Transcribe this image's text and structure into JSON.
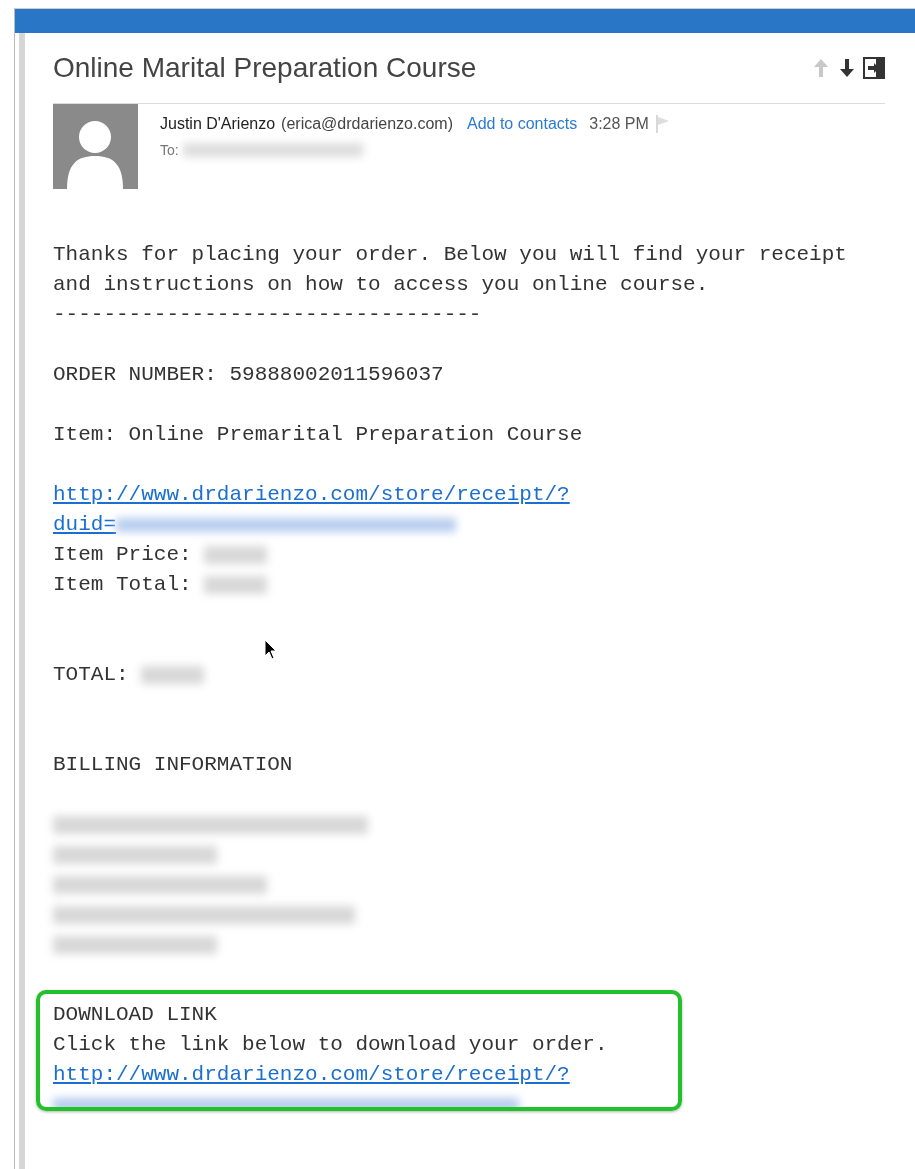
{
  "window": {
    "title": "Online Marital Preparation Course"
  },
  "toolbar_buttons": [
    {
      "kind": "previous",
      "disabled": true
    },
    {
      "kind": "next",
      "disabled": false
    },
    {
      "kind": "pop-out",
      "disabled": false
    }
  ],
  "sender": {
    "name": "Justin D'Arienzo",
    "email": "(erica@drdarienzo.com)",
    "add_contact": "Add to contacts",
    "time": "3:28 PM",
    "to_label": "To:"
  },
  "body_lines": [
    {
      "kind": "text",
      "text": "Thanks for placing your order. Below you will find your receipt"
    },
    {
      "kind": "text",
      "text": "and instructions on how to access you online course."
    },
    {
      "kind": "text",
      "text": "----------------------------------"
    },
    {
      "kind": "blank"
    },
    {
      "kind": "text",
      "text": "ORDER NUMBER: 59888002011596037"
    },
    {
      "kind": "blank"
    },
    {
      "kind": "text",
      "text": "Item: Online Premarital Preparation Course"
    },
    {
      "kind": "blank"
    },
    {
      "kind": "link",
      "text": "http://www.drdarienzo.com/store/receipt/?"
    },
    {
      "kind": "link-redacted",
      "text": "duid="
    },
    {
      "kind": "text-redacted",
      "text": "Item Price:"
    },
    {
      "kind": "text-redacted",
      "text": "Item Total:"
    },
    {
      "kind": "blank"
    },
    {
      "kind": "blank"
    },
    {
      "kind": "text-redacted",
      "text": "TOTAL:"
    },
    {
      "kind": "blank"
    },
    {
      "kind": "blank"
    },
    {
      "kind": "text",
      "text": "BILLING INFORMATION"
    },
    {
      "kind": "blank"
    },
    {
      "kind": "redacted"
    },
    {
      "kind": "redacted"
    },
    {
      "kind": "redacted"
    },
    {
      "kind": "redacted"
    },
    {
      "kind": "redacted"
    },
    {
      "kind": "blank"
    }
  ],
  "highlighted_section": {
    "lines": [
      {
        "kind": "text",
        "text": "DOWNLOAD LINK"
      },
      {
        "kind": "text",
        "text": "Click the link below to download your order."
      },
      {
        "kind": "link",
        "text": "http://www.drdarienzo.com/store/receipt/?"
      },
      {
        "kind": "link-redacted-full"
      }
    ]
  }
}
